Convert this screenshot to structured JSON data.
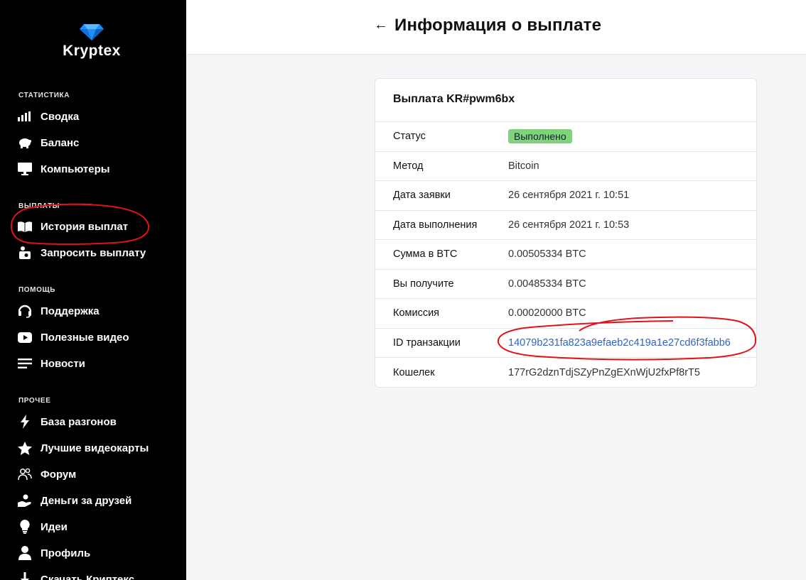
{
  "brand": {
    "name": "Kryptex"
  },
  "sidebar": {
    "sections": [
      {
        "title": "СТАТИСТИКА",
        "items": [
          {
            "label": "Сводка",
            "icon": "bar-chart-icon"
          },
          {
            "label": "Баланс",
            "icon": "piggy-bank-icon"
          },
          {
            "label": "Компьютеры",
            "icon": "monitor-icon"
          }
        ]
      },
      {
        "title": "ВЫПЛАТЫ",
        "items": [
          {
            "label": "История выплат",
            "icon": "book-icon"
          },
          {
            "label": "Запросить выплату",
            "icon": "payout-request-icon"
          }
        ]
      },
      {
        "title": "ПОМОЩЬ",
        "items": [
          {
            "label": "Поддержка",
            "icon": "headset-icon"
          },
          {
            "label": "Полезные видео",
            "icon": "youtube-icon"
          },
          {
            "label": "Новости",
            "icon": "news-icon"
          }
        ]
      },
      {
        "title": "ПРОЧЕЕ",
        "items": [
          {
            "label": "База разгонов",
            "icon": "lightning-icon"
          },
          {
            "label": "Лучшие видеокарты",
            "icon": "star-icon"
          },
          {
            "label": "Форум",
            "icon": "users-icon"
          },
          {
            "label": "Деньги за друзей",
            "icon": "hand-coin-icon"
          },
          {
            "label": "Идеи",
            "icon": "lightbulb-icon"
          },
          {
            "label": "Профиль",
            "icon": "user-icon"
          },
          {
            "label": "Скачать Криптекс",
            "icon": "download-icon"
          }
        ]
      }
    ]
  },
  "header": {
    "title": "Информация о выплате",
    "back_icon": "arrow-left-icon"
  },
  "payout": {
    "title": "Выплата KR#pwm6bx",
    "rows": [
      {
        "key": "Статус",
        "value": "Выполнено"
      },
      {
        "key": "Метод",
        "value": "Bitcoin"
      },
      {
        "key": "Дата заявки",
        "value": "26 сентября 2021 г. 10:51"
      },
      {
        "key": "Дата выполнения",
        "value": "26 сентября 2021 г. 10:53"
      },
      {
        "key": "Сумма в BTC",
        "value": "0.00505334 BTC"
      },
      {
        "key": "Вы получите",
        "value": "0.00485334 BTC"
      },
      {
        "key": "Комиссия",
        "value": "0.00020000 BTC"
      },
      {
        "key": "ID транзакции",
        "value": "14079b231fa823a9efaeb2c419a1e27cd6f3fabb6"
      },
      {
        "key": "Кошелек",
        "value": "177rG2dznTdjSZyPnZgEXnWjU2fxPf8rT5"
      }
    ]
  },
  "colors": {
    "sidebar_bg": "#000000",
    "status_green": "#7fd37a",
    "link_blue": "#2f64c8",
    "annotation_red": "#e0121b"
  }
}
